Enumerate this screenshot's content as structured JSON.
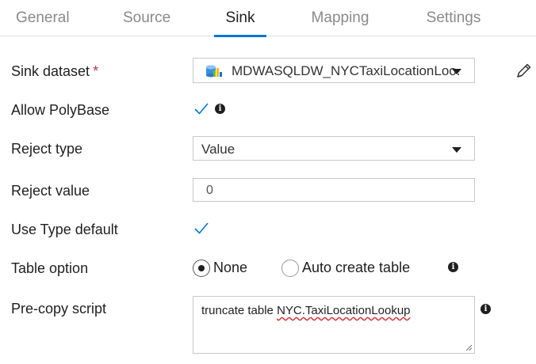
{
  "tabs": [
    {
      "label": "General"
    },
    {
      "label": "Source"
    },
    {
      "label": "Sink"
    },
    {
      "label": "Mapping"
    },
    {
      "label": "Settings"
    }
  ],
  "active_tab": "Sink",
  "form": {
    "sink_dataset": {
      "label": "Sink dataset",
      "required_marker": "*",
      "value": "MDWASQLDW_NYCTaxiLocationLoo...",
      "icon": "sql-datawarehouse-icon"
    },
    "allow_polybase": {
      "label": "Allow PolyBase",
      "checked": true
    },
    "reject_type": {
      "label": "Reject type",
      "value": "Value"
    },
    "reject_value": {
      "label": "Reject value",
      "value": "0"
    },
    "use_type_default": {
      "label": "Use Type default",
      "checked": true
    },
    "table_option": {
      "label": "Table option",
      "options": [
        {
          "label": "None",
          "selected": true
        },
        {
          "label": "Auto create table",
          "selected": false
        }
      ]
    },
    "pre_copy_script": {
      "label": "Pre-copy script",
      "value_prefix": "truncate table ",
      "value_misspelled": "NYC.TaxiLocationLookup"
    }
  },
  "colors": {
    "accent": "#0078d4",
    "required": "#c4314b",
    "spellcheck": "#d13438"
  }
}
